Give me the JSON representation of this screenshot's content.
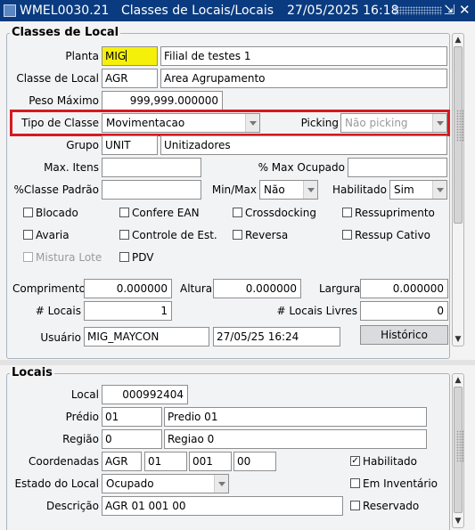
{
  "title": {
    "form_code": "WMEL0030.21",
    "form_name": "Classes de Locais/Locais",
    "datetime": "27/05/2025 16:18",
    "minimize_glyph": "⇲",
    "close_glyph": "✕",
    "icon": "app-icon"
  },
  "classes": {
    "title": "Classes de Local",
    "planta": {
      "label": "Planta",
      "code": "MIG",
      "name": "Filial de testes 1"
    },
    "classe_local": {
      "label": "Classe de Local",
      "code": "AGR",
      "name": "Area Agrupamento"
    },
    "peso_maximo": {
      "label": "Peso Máximo",
      "value": "999,999.000000"
    },
    "tipo_classe": {
      "label": "Tipo de Classe",
      "value": "Movimentacao"
    },
    "picking": {
      "label": "Picking",
      "value": "Não picking"
    },
    "grupo": {
      "label": "Grupo",
      "code": "UNIT",
      "name": "Unitizadores"
    },
    "max_itens": {
      "label": "Max. Itens",
      "value": ""
    },
    "max_ocupado": {
      "label": "% Max Ocupado",
      "value": ""
    },
    "classe_padrao": {
      "label": "%Classe Padrão",
      "value": ""
    },
    "min_max": {
      "label": "Min/Max",
      "value": "Não"
    },
    "habilitado": {
      "label": "Habilitado",
      "value": "Sim"
    },
    "checks": {
      "bloqueado": {
        "label": "Blocado",
        "checked": false
      },
      "confere_ean": {
        "label": "Confere EAN",
        "checked": false
      },
      "crossdocking": {
        "label": "Crossdocking",
        "checked": false
      },
      "ressuprimento": {
        "label": "Ressuprimento",
        "checked": false
      },
      "avaria": {
        "label": "Avaria",
        "checked": false
      },
      "controle_est": {
        "label": "Controle de Est.",
        "checked": false
      },
      "reversa": {
        "label": "Reversa",
        "checked": false
      },
      "ressup_cativo": {
        "label": "Ressup Cativo",
        "checked": false
      },
      "mistura_lote": {
        "label": "Mistura Lote",
        "checked": false
      },
      "pdv": {
        "label": "PDV",
        "checked": false
      }
    },
    "comprimento": {
      "label": "Comprimento",
      "value": "0.000000"
    },
    "altura": {
      "label": "Altura",
      "value": "0.000000"
    },
    "largura": {
      "label": "Largura",
      "value": "0.000000"
    },
    "num_locais": {
      "label": "# Locais",
      "value": "1"
    },
    "num_locais_livres": {
      "label": "# Locais Livres",
      "value": "0"
    },
    "usuario": {
      "label": "Usuário",
      "value": "MIG_MAYCON",
      "date": "27/05/25 16:24"
    },
    "historico_button": "Histórico"
  },
  "locais": {
    "title": "Locais",
    "local": {
      "label": "Local",
      "value": "000992404"
    },
    "predio": {
      "label": "Prédio",
      "code": "01",
      "name": "Predio 01"
    },
    "regiao": {
      "label": "Região",
      "code": "0",
      "name": "Regiao 0"
    },
    "coordenadas": {
      "label": "Coordenadas",
      "v1": "AGR",
      "v2": "01",
      "v3": "001",
      "v4": "00"
    },
    "estado": {
      "label": "Estado do Local",
      "value": "Ocupado"
    },
    "descricao": {
      "label": "Descrição",
      "value": "AGR 01 001 00"
    },
    "habilitado": {
      "label": "Habilitado",
      "checked": true
    },
    "em_inventario": {
      "label": "Em Inventário",
      "checked": false
    },
    "reservado": {
      "label": "Reservado",
      "checked": false
    }
  },
  "colors": {
    "title_bar": "#0a3b80",
    "highlight_field": "#f5f00a",
    "highlight_border": "#d71920"
  }
}
